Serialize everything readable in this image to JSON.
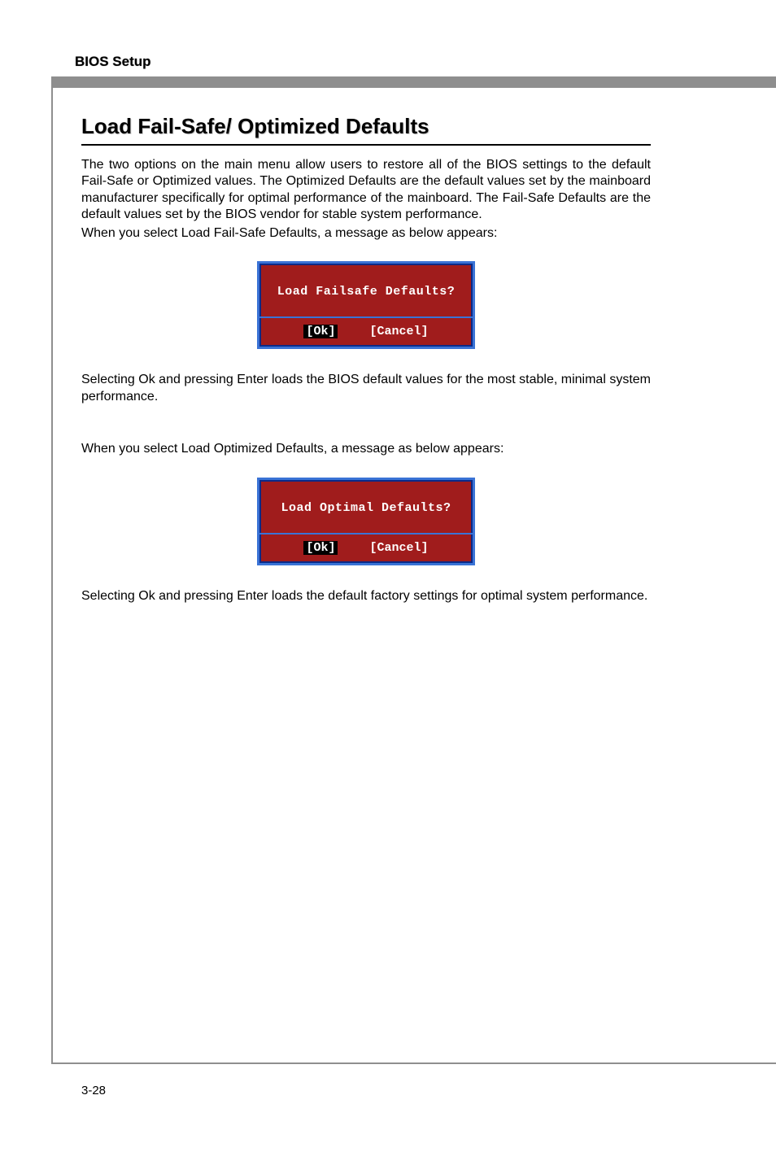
{
  "header": {
    "label": "BIOS Setup"
  },
  "section": {
    "title": "Load Fail-Safe/ Optimized Defaults"
  },
  "paragraphs": {
    "p1": "The two options on the main menu allow users to restore all of the BIOS settings to the default Fail-Safe or Optimized values. The Optimized Defaults are the default values set by the mainboard manufacturer specifically for optimal performance of the mainboard. The Fail-Safe Defaults are the default values set by the BIOS vendor for stable system performance.",
    "p2": "When you select Load Fail-Safe Defaults, a message as below appears:",
    "p3": "Selecting Ok and pressing Enter loads the BIOS default values for the most stable, minimal system performance.",
    "p4": "When you select Load Optimized Defaults, a message as below appears:",
    "p5": "Selecting Ok and pressing Enter loads the default factory settings for optimal system performance."
  },
  "dialog1": {
    "prompt": "Load Failsafe Defaults?",
    "ok": "[Ok]",
    "cancel": "[Cancel]"
  },
  "dialog2": {
    "prompt": "Load Optimal Defaults?",
    "ok": "[Ok]",
    "cancel": "[Cancel]"
  },
  "footer": {
    "page": "3-28"
  }
}
